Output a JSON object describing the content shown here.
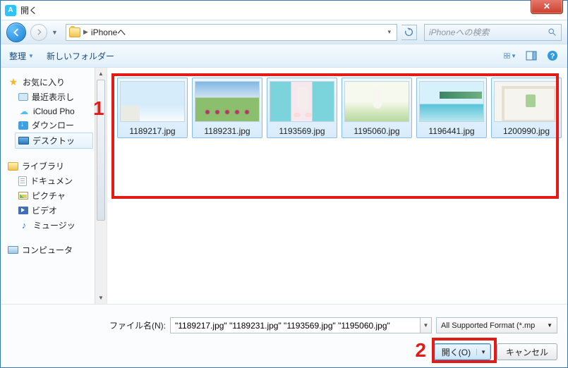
{
  "window": {
    "title": "開く"
  },
  "nav": {
    "path_label": "iPhoneへ",
    "search_placeholder": "iPhoneへの検索"
  },
  "toolbar": {
    "organize": "整理",
    "new_folder": "新しいフォルダー"
  },
  "sidebar": {
    "favorites": {
      "label": "お気に入り",
      "items": [
        {
          "label": "最近表示し"
        },
        {
          "label": "iCloud Pho"
        },
        {
          "label": "ダウンロー"
        },
        {
          "label": "デスクトッ"
        }
      ]
    },
    "libraries": {
      "label": "ライブラリ",
      "items": [
        {
          "label": "ドキュメン"
        },
        {
          "label": "ピクチャ"
        },
        {
          "label": "ビデオ"
        },
        {
          "label": "ミュージッ"
        }
      ]
    },
    "computer": {
      "label": "コンピュータ"
    }
  },
  "files": [
    {
      "name": "1189217.jpg"
    },
    {
      "name": "1189231.jpg"
    },
    {
      "name": "1193569.jpg"
    },
    {
      "name": "1195060.jpg"
    },
    {
      "name": "1196441.jpg"
    },
    {
      "name": "1200990.jpg"
    }
  ],
  "footer": {
    "filename_label": "ファイル名(N):",
    "filename_value": "\"1189217.jpg\" \"1189231.jpg\" \"1193569.jpg\" \"1195060.jpg\"",
    "format_label": "All Supported Format (*.mp",
    "open_label": "開く(O)",
    "cancel_label": "キャンセル"
  },
  "callouts": {
    "one": "1",
    "two": "2"
  }
}
